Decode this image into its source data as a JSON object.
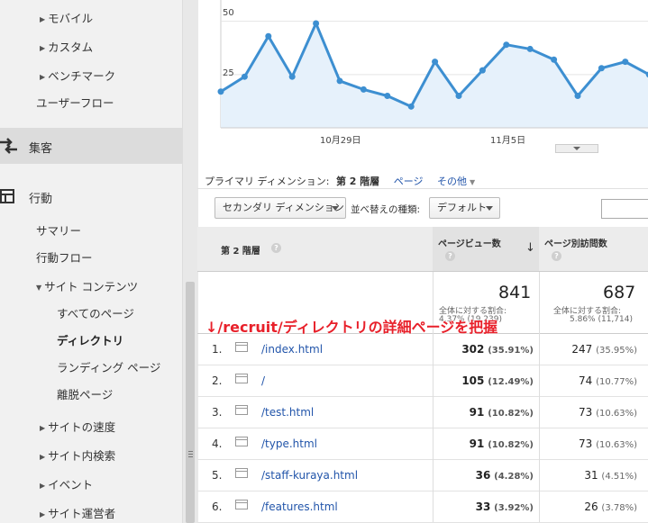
{
  "sidebar": {
    "items": [
      {
        "label": "モバイル",
        "kind": "collapsed"
      },
      {
        "label": "カスタム",
        "kind": "collapsed"
      },
      {
        "label": "ベンチマーク",
        "kind": "collapsed"
      },
      {
        "label": "ユーザーフロー",
        "kind": "plain"
      }
    ],
    "sections": [
      {
        "label": "集客",
        "icon": "acquisition-arrows-icon",
        "active": true
      },
      {
        "label": "行動",
        "icon": "behavior-grid-icon",
        "active": false
      }
    ],
    "behavior": {
      "summary": "サマリー",
      "flow": "行動フロー",
      "site_content": "サイト コンテンツ",
      "all_pages": "すべてのページ",
      "directory": "ディレクトリ",
      "landing": "ランディング ページ",
      "exit": "離脱ページ",
      "speed": "サイトの速度",
      "search": "サイト内検索",
      "events": "イベント",
      "publisher": "サイト運営者"
    }
  },
  "chart_data": {
    "type": "area",
    "y_ticks": [
      "50",
      "25"
    ],
    "x_ticks": [
      "10月29日",
      "11月5日"
    ],
    "ylim": [
      0,
      60
    ],
    "values": [
      17,
      24,
      43,
      24,
      49,
      22,
      18,
      15,
      10,
      31,
      15,
      27,
      39,
      37,
      32,
      15,
      28,
      31,
      25
    ],
    "color": "#3d8fd1",
    "fill": "#e6f1fb"
  },
  "dimension": {
    "label": "プライマリ ディメンション:",
    "current": "第 2 階層",
    "page": "ページ",
    "other": "その他"
  },
  "controls": {
    "secondary": "セカンダリ ディメンション",
    "sort_label": "並べ替えの種類:",
    "sort_value": "デフォルト"
  },
  "table": {
    "col1": "第 2 階層",
    "col2": "ページビュー数",
    "col3": "ページ別訪問数",
    "summary": {
      "pv": "841",
      "pv_note": "全体に対する割合:",
      "pv_pct": "4.37% (19,239)",
      "uv": "687",
      "uv_note": "全体に対する割合:",
      "uv_pct": "5.86% (11,714)"
    },
    "rows": [
      {
        "n": "1.",
        "path": "/index.html",
        "pv": "302",
        "pvp": "(35.91%)",
        "uv": "247",
        "uvp": "(35.95%)"
      },
      {
        "n": "2.",
        "path": "/",
        "pv": "105",
        "pvp": "(12.49%)",
        "uv": "74",
        "uvp": "(10.77%)"
      },
      {
        "n": "3.",
        "path": "/test.html",
        "pv": "91",
        "pvp": "(10.82%)",
        "uv": "73",
        "uvp": "(10.63%)"
      },
      {
        "n": "4.",
        "path": "/type.html",
        "pv": "91",
        "pvp": "(10.82%)",
        "uv": "73",
        "uvp": "(10.63%)"
      },
      {
        "n": "5.",
        "path": "/staff-kuraya.html",
        "pv": "36",
        "pvp": "(4.28%)",
        "uv": "31",
        "uvp": "(4.51%)"
      },
      {
        "n": "6.",
        "path": "/features.html",
        "pv": "33",
        "pvp": "(3.92%)",
        "uv": "26",
        "uvp": "(3.78%)"
      }
    ]
  },
  "annotation": "↓/recruit/ディレクトリの詳細ページを把握",
  "colors": {
    "link": "#2255aa",
    "annotation": "#e8202a",
    "line": "#3d8fd1"
  }
}
